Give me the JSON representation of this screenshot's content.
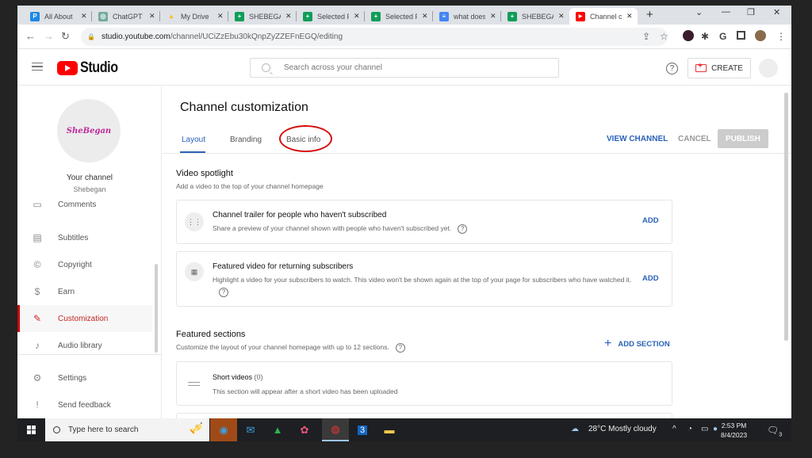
{
  "browser": {
    "tabs": [
      {
        "title": "All About",
        "favicon": "P",
        "color": "#1e88e5"
      },
      {
        "title": "ChatGPT",
        "favicon": "◎",
        "color": "#74aa9c"
      },
      {
        "title": "My Drive",
        "favicon": "▲",
        "color": "#fbbc04"
      },
      {
        "title": "SHEBEGAN",
        "favicon": "+",
        "color": "#0f9d58"
      },
      {
        "title": "Selected P",
        "favicon": "+",
        "color": "#0f9d58"
      },
      {
        "title": "Selected P",
        "favicon": "+",
        "color": "#0f9d58"
      },
      {
        "title": "what does",
        "favicon": "≡",
        "color": "#4285f4"
      },
      {
        "title": "SHEBEGAN",
        "favicon": "+",
        "color": "#0f9d58"
      },
      {
        "title": "Channel c",
        "favicon": "▶",
        "color": "#ff0000",
        "active": true
      }
    ],
    "new_tab": "+",
    "window_controls": {
      "dropdown": "⌄",
      "minimize": "—",
      "restore": "❐",
      "close": "✕"
    },
    "url_domain": "studio.youtube.com",
    "url_path": "/channel/UCiZzEbu30kQnpZyZZEFnEGQ/editing",
    "ext_letter": "G"
  },
  "header": {
    "logo_text": "Studio",
    "search_placeholder": "Search across your channel",
    "help": "?",
    "create_label": "CREATE"
  },
  "sidebar": {
    "channel_logo_text": "SheBegan",
    "channel_label": "Your channel",
    "channel_name": "Shebegan",
    "items": [
      {
        "label": "Comments",
        "icon": "comments-icon",
        "glyph": "▭"
      },
      {
        "label": "Subtitles",
        "icon": "subtitles-icon",
        "glyph": "▤"
      },
      {
        "label": "Copyright",
        "icon": "copyright-icon",
        "glyph": "©"
      },
      {
        "label": "Earn",
        "icon": "dollar-icon",
        "glyph": "$"
      },
      {
        "label": "Customization",
        "icon": "magic-wand-icon",
        "glyph": "✎",
        "active": true
      },
      {
        "label": "Audio library",
        "icon": "audio-library-icon",
        "glyph": "♪"
      }
    ],
    "footer_items": [
      {
        "label": "Settings",
        "icon": "gear-icon",
        "glyph": "⚙"
      },
      {
        "label": "Send feedback",
        "icon": "feedback-icon",
        "glyph": "!"
      }
    ]
  },
  "main": {
    "title": "Channel customization",
    "tabs": [
      {
        "label": "Layout",
        "active": true
      },
      {
        "label": "Branding"
      },
      {
        "label": "Basic info",
        "highlighted": true
      }
    ],
    "actions": {
      "view_channel": "VIEW CHANNEL",
      "cancel": "CANCEL",
      "publish": "PUBLISH"
    },
    "video_spotlight": {
      "title": "Video spotlight",
      "description": "Add a video to the top of your channel homepage",
      "cards": [
        {
          "title": "Channel trailer for people who haven't subscribed",
          "description": "Share a preview of your channel shown with people who haven't subscribed yet.",
          "action": "ADD"
        },
        {
          "title": "Featured video for returning subscribers",
          "description": "Highlight a video for your subscribers to watch. This video won't be shown again at the top of your page for subscribers who have watched it.",
          "action": "ADD"
        }
      ]
    },
    "featured_sections": {
      "title": "Featured sections",
      "description": "Customize the layout of your channel homepage with up to 12 sections.",
      "add_label": "ADD SECTION",
      "sections": [
        {
          "title": "Short videos",
          "count": "(0)",
          "description": "This section will appear after a short video has been uploaded"
        }
      ]
    }
  },
  "taskbar": {
    "search_placeholder": "Type here to search",
    "weather": "28°C  Mostly cloudy",
    "time": "2:53 PM",
    "date": "8/4/2023",
    "notification_count": "3"
  }
}
